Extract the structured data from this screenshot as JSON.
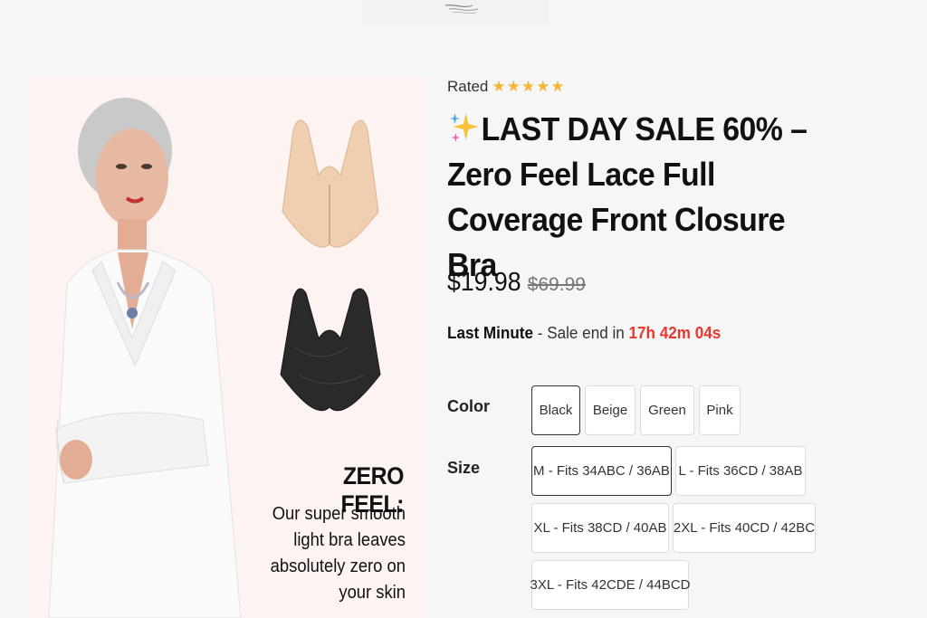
{
  "product": {
    "rated_label": "Rated",
    "rating_stars": 5,
    "title": "LAST DAY SALE 60% – Zero Feel Lace Full Coverage Front Closure Bra",
    "price": "$19.98",
    "old_price": "$69.99"
  },
  "sale": {
    "prefix": "Last Minute",
    "middle": " - Sale end in ",
    "timer": "17h 42m 04s"
  },
  "hero": {
    "headline": "ZERO FEEL:",
    "body_lines": [
      "Our super smooth",
      "light bra leaves",
      "absolutely zero on",
      "your skin"
    ]
  },
  "options": {
    "color_label": "Color",
    "colors": [
      "Black",
      "Beige",
      "Green",
      "Pink"
    ],
    "selected_color": "Black",
    "size_label": "Size",
    "sizes": [
      "M - Fits 34ABC / 36AB",
      "L - Fits 36CD / 38AB",
      "XL - Fits 38CD / 40AB",
      "2XL - Fits 40CD / 42BC",
      "3XL - Fits 42CDE / 44BCD"
    ],
    "selected_size": "M - Fits 34ABC / 36AB"
  },
  "colors": {
    "star": "#f5b731",
    "timer": "#e8382d",
    "hero_bg": "#fdf3f1"
  }
}
